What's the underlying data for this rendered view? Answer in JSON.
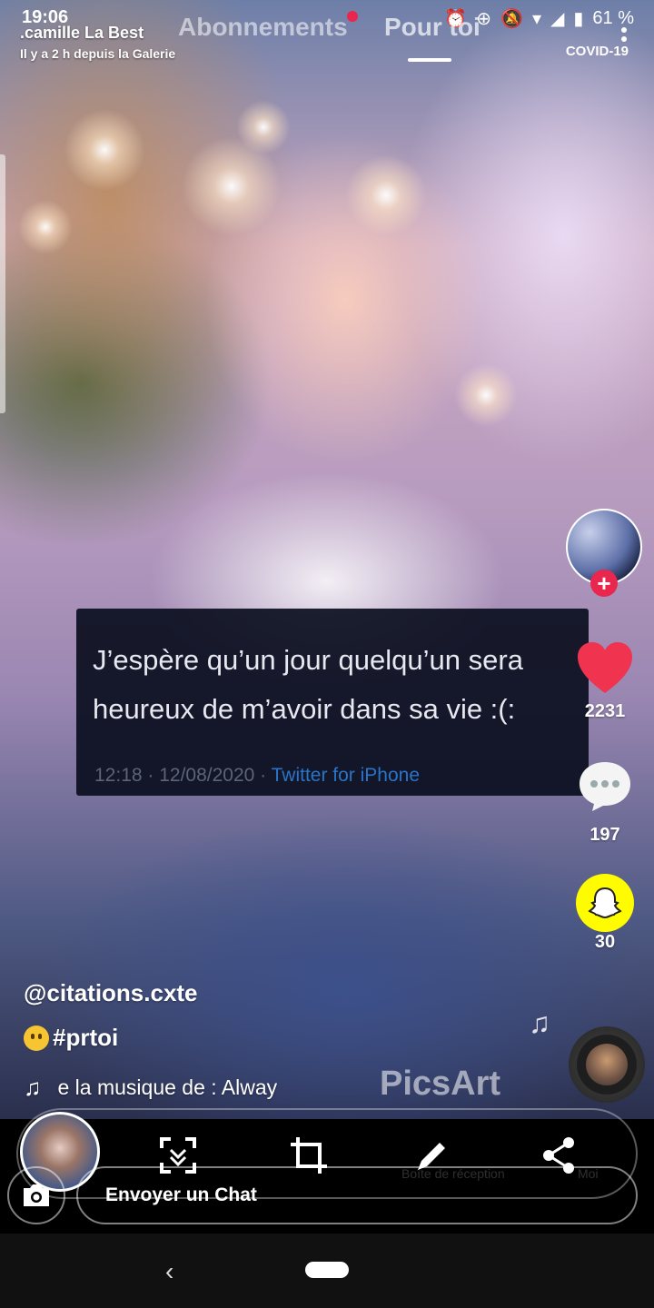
{
  "status_bar": {
    "time": "19:06",
    "battery": "61 %"
  },
  "story": {
    "username": ".camille La Best",
    "meta": "Il y a 2 h depuis la Galerie"
  },
  "tabs": {
    "following": "Abonnements",
    "for_you": "Pour toi"
  },
  "covid_label": "COVID-19",
  "tweet": {
    "text": "J’espère qu’un jour quelqu’un sera\nheureux de m’avoir dans sa vie :(:",
    "time": "12:18 · 12/08/2020 · ",
    "client": "Twitter for iPhone"
  },
  "rail": {
    "likes": "2231",
    "comments": "197",
    "shares": "30"
  },
  "caption": {
    "username": "@citations.cxte",
    "hashtag": "#prtoi"
  },
  "music": {
    "text": "e la musique de : Alway"
  },
  "watermark": "PicsArt",
  "snap": {
    "chat_placeholder": "Envoyer un Chat",
    "ghost_inbox": "Boîte de réception",
    "ghost_me": "Moi"
  },
  "colors": {
    "accent_red": "#e8264e",
    "snap_yellow": "#fffc00",
    "twitter_blue": "#2a74c7"
  }
}
